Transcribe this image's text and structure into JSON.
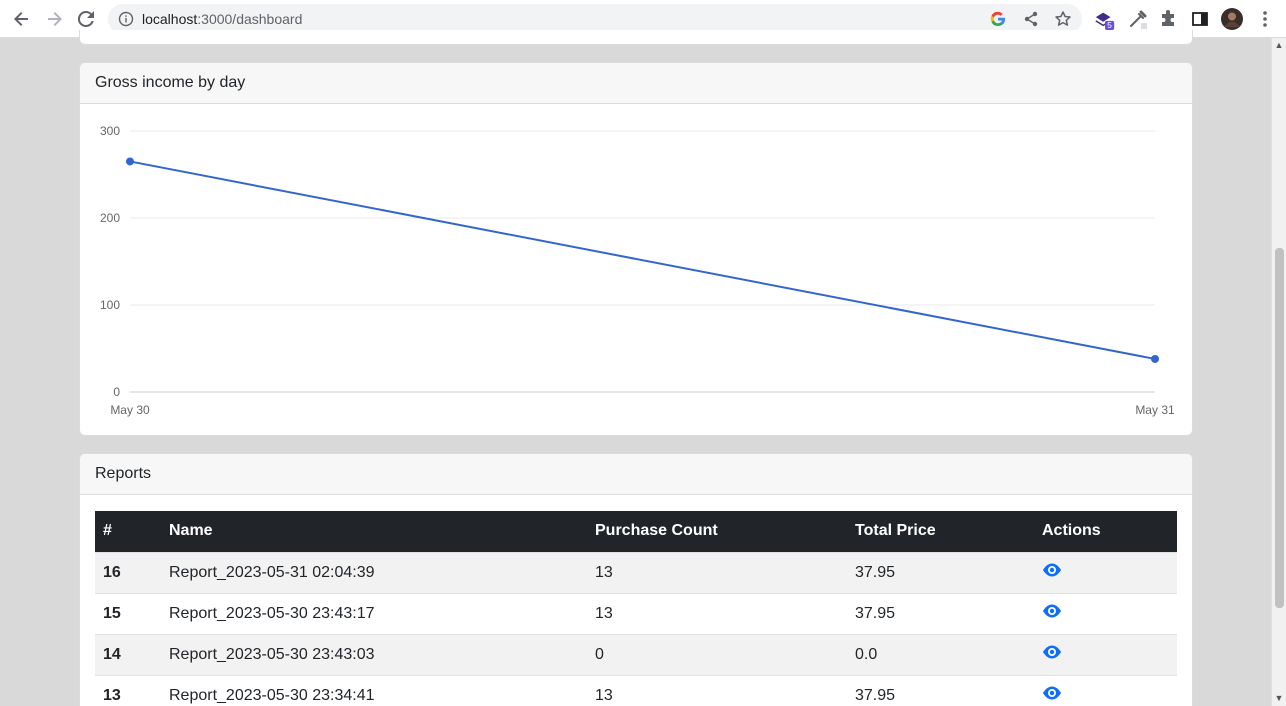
{
  "browser": {
    "url_host": "localhost",
    "url_path": ":3000/dashboard",
    "extension_badge": "5"
  },
  "income_card": {
    "title": "Gross income by day"
  },
  "chart_data": {
    "type": "line",
    "title": "",
    "xlabel": "",
    "ylabel": "",
    "x": [
      "May 30",
      "May 31"
    ],
    "series": [
      {
        "values": [
          265,
          38
        ],
        "color": "#3366cc"
      }
    ],
    "ylim": [
      0,
      300
    ],
    "yticks": [
      "0",
      "100",
      "200",
      "300"
    ],
    "grid": true,
    "legend": "none"
  },
  "reports_card": {
    "title": "Reports",
    "columns": [
      "#",
      "Name",
      "Purchase Count",
      "Total Price",
      "Actions"
    ],
    "rows": [
      {
        "id": "16",
        "name": "Report_2023-05-31 02:04:39",
        "count": "13",
        "price": "37.95",
        "action_icon": "eye-icon"
      },
      {
        "id": "15",
        "name": "Report_2023-05-30 23:43:17",
        "count": "13",
        "price": "37.95",
        "action_icon": "eye-icon"
      },
      {
        "id": "14",
        "name": "Report_2023-05-30 23:43:03",
        "count": "0",
        "price": "0.0",
        "action_icon": "eye-icon"
      },
      {
        "id": "13",
        "name": "Report_2023-05-30 23:34:41",
        "count": "13",
        "price": "37.95",
        "action_icon": "eye-icon"
      }
    ]
  },
  "colors": {
    "accent": "#3366cc",
    "action_blue": "#0d6efd",
    "table_header": "#212529"
  }
}
